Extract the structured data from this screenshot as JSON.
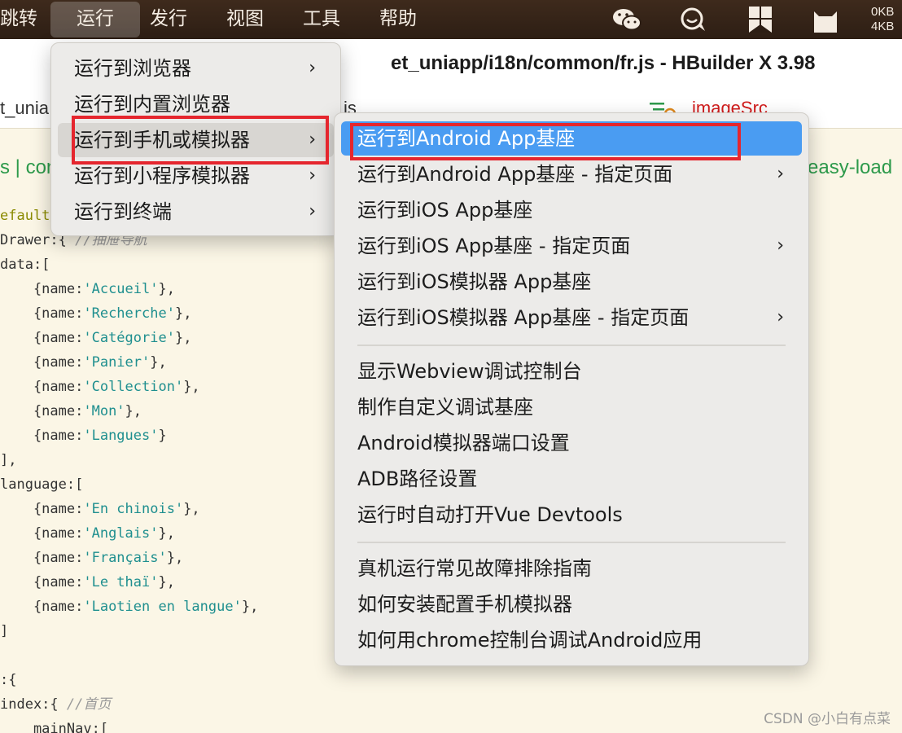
{
  "menubar": {
    "items": [
      {
        "label": "跳转"
      },
      {
        "label": "运行",
        "active": true
      },
      {
        "label": "发行"
      },
      {
        "label": "视图"
      },
      {
        "label": "工具"
      },
      {
        "label": "帮助"
      }
    ],
    "tray": {
      "icons": [
        "wechat-icon",
        "chat-bubble-icon",
        "bookmark-grid-icon",
        "cat-icon"
      ],
      "net_up": "0KB",
      "net_down": "4KB"
    }
  },
  "window": {
    "title": "et_uniapp/i18n/common/fr.js - HBuilder X 3.98"
  },
  "tabs": {
    "left": "t_unia",
    "mid": "is",
    "image_tab": "imageSrc"
  },
  "breadcrumb": {
    "left": "s | con",
    "right": "easy-load"
  },
  "code": [
    {
      "pre": "efault",
      "parts": []
    },
    {
      "pre": "Drawer:{ ",
      "comment": "//抽屉导航"
    },
    {
      "pre": "data:["
    },
    {
      "indent": "    {name:",
      "str": "'Accueil'",
      "post": "},"
    },
    {
      "indent": "    {name:",
      "str": "'Recherche'",
      "post": "},"
    },
    {
      "indent": "    {name:",
      "str": "'Catégorie'",
      "post": "},"
    },
    {
      "indent": "    {name:",
      "str": "'Panier'",
      "post": "},"
    },
    {
      "indent": "    {name:",
      "str": "'Collection'",
      "post": "},"
    },
    {
      "indent": "    {name:",
      "str": "'Mon'",
      "post": "},"
    },
    {
      "indent": "    {name:",
      "str": "'Langues'",
      "post": "}"
    },
    {
      "pre": "],"
    },
    {
      "pre": "language:["
    },
    {
      "indent": "    {name:",
      "str": "'En chinois'",
      "post": "},"
    },
    {
      "indent": "    {name:",
      "str": "'Anglais'",
      "post": "},"
    },
    {
      "indent": "    {name:",
      "str": "'Français'",
      "post": "},"
    },
    {
      "indent": "    {name:",
      "str": "'Le thaï'",
      "post": "},"
    },
    {
      "indent": "    {name:",
      "str": "'Laotien en langue'",
      "post": "},"
    },
    {
      "pre": "]"
    },
    {
      "pre": ""
    },
    {
      "pre": ":{"
    },
    {
      "pre": "index:{ ",
      "comment": "//首页"
    },
    {
      "pre": "    mainNav:["
    }
  ],
  "run_menu": {
    "items": [
      {
        "label": "运行到浏览器",
        "submenu": true
      },
      {
        "label": "运行到内置浏览器",
        "submenu": false
      },
      {
        "label": "运行到手机或模拟器",
        "submenu": true,
        "hover": true
      },
      {
        "label": "运行到小程序模拟器",
        "submenu": true
      },
      {
        "label": "运行到终端",
        "submenu": true
      }
    ]
  },
  "device_menu": {
    "group1": [
      {
        "label": "运行到Android App基座",
        "submenu": false,
        "selected": true
      },
      {
        "label": "运行到Android App基座 - 指定页面",
        "submenu": true
      },
      {
        "label": "运行到iOS App基座",
        "submenu": false
      },
      {
        "label": "运行到iOS App基座 - 指定页面",
        "submenu": true
      },
      {
        "label": "运行到iOS模拟器 App基座",
        "submenu": false
      },
      {
        "label": "运行到iOS模拟器 App基座 - 指定页面",
        "submenu": true
      }
    ],
    "group2": [
      {
        "label": "显示Webview调试控制台"
      },
      {
        "label": "制作自定义调试基座"
      },
      {
        "label": "Android模拟器端口设置"
      },
      {
        "label": "ADB路径设置"
      },
      {
        "label": "运行时自动打开Vue Devtools"
      }
    ],
    "group3": [
      {
        "label": "真机运行常见故障排除指南"
      },
      {
        "label": "如何安装配置手机模拟器"
      },
      {
        "label": "如何用chrome控制台调试Android应用"
      }
    ]
  },
  "chevron": "›",
  "watermark": "CSDN @小白有点菜",
  "colors": {
    "selection": "#4a9cf2",
    "annotation": "#e5262e",
    "string": "#1f8f8f"
  }
}
